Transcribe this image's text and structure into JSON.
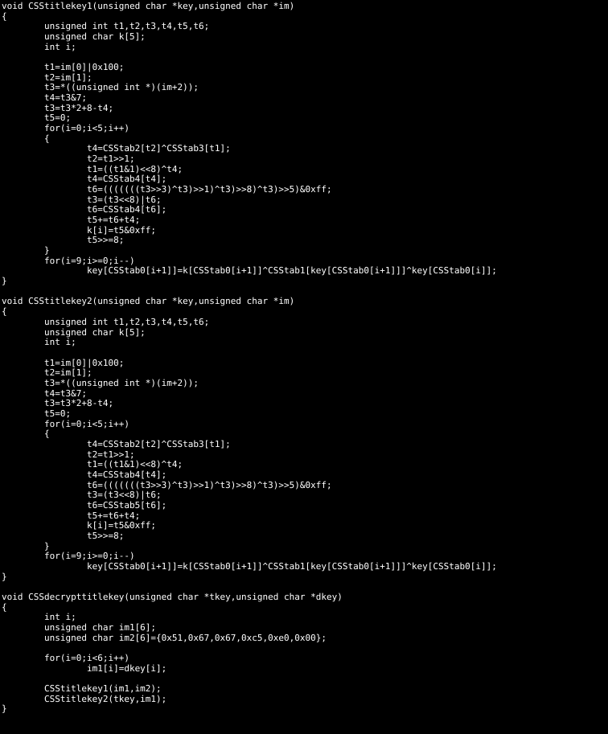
{
  "document": {
    "kind": "source-code-listing",
    "language": "C",
    "background_color": "#000000",
    "text_color": "#ffffff",
    "lines": [
      "void CSStitlekey1(unsigned char *key,unsigned char *im)",
      "{",
      "        unsigned int t1,t2,t3,t4,t5,t6;",
      "        unsigned char k[5];",
      "        int i;",
      "",
      "        t1=im[0]|0x100;",
      "        t2=im[1];",
      "        t3=*((unsigned int *)(im+2));",
      "        t4=t3&7;",
      "        t3=t3*2+8-t4;",
      "        t5=0;",
      "        for(i=0;i<5;i++)",
      "        {",
      "                t4=CSStab2[t2]^CSStab3[t1];",
      "                t2=t1>>1;",
      "                t1=((t1&1)<<8)^t4;",
      "                t4=CSStab4[t4];",
      "                t6=(((((((t3>>3)^t3)>>1)^t3)>>8)^t3)>>5)&0xff;",
      "                t3=(t3<<8)|t6;",
      "                t6=CSStab4[t6];",
      "                t5+=t6+t4;",
      "                k[i]=t5&0xff;",
      "                t5>>=8;",
      "        }",
      "        for(i=9;i>=0;i--)",
      "                key[CSStab0[i+1]]=k[CSStab0[i+1]]^CSStab1[key[CSStab0[i+1]]]^key[CSStab0[i]];",
      "}",
      "",
      "void CSStitlekey2(unsigned char *key,unsigned char *im)",
      "{",
      "        unsigned int t1,t2,t3,t4,t5,t6;",
      "        unsigned char k[5];",
      "        int i;",
      "",
      "        t1=im[0]|0x100;",
      "        t2=im[1];",
      "        t3=*((unsigned int *)(im+2));",
      "        t4=t3&7;",
      "        t3=t3*2+8-t4;",
      "        t5=0;",
      "        for(i=0;i<5;i++)",
      "        {",
      "                t4=CSStab2[t2]^CSStab3[t1];",
      "                t2=t1>>1;",
      "                t1=((t1&1)<<8)^t4;",
      "                t4=CSStab4[t4];",
      "                t6=(((((((t3>>3)^t3)>>1)^t3)>>8)^t3)>>5)&0xff;",
      "                t3=(t3<<8)|t6;",
      "                t6=CSStab5[t6];",
      "                t5+=t6+t4;",
      "                k[i]=t5&0xff;",
      "                t5>>=8;",
      "        }",
      "        for(i=9;i>=0;i--)",
      "                key[CSStab0[i+1]]=k[CSStab0[i+1]]^CSStab1[key[CSStab0[i+1]]]^key[CSStab0[i]];",
      "}",
      "",
      "void CSSdecrypttitlekey(unsigned char *tkey,unsigned char *dkey)",
      "{",
      "        int i;",
      "        unsigned char im1[6];",
      "        unsigned char im2[6]={0x51,0x67,0x67,0xc5,0xe0,0x00};",
      "",
      "        for(i=0;i<6;i++)",
      "                im1[i]=dkey[i];",
      "",
      "        CSStitlekey1(im1,im2);",
      "        CSStitlekey2(tkey,im1);",
      "}"
    ]
  }
}
